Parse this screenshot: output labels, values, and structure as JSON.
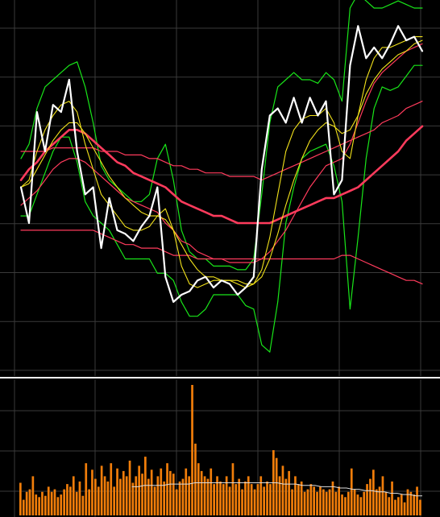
{
  "colors": {
    "background": "#000000",
    "grid": "#3a3a3a",
    "price": "#ffffff",
    "ma_short": "#f2e21b",
    "ma_long": "#ff3b5c",
    "bollinger": "#19e619",
    "volume": "#f07d0a",
    "volume_avg": "#dddddd",
    "separator": "#ffffff"
  },
  "chart_data": [
    {
      "type": "line",
      "panel": "price",
      "title": "",
      "xlabel": "",
      "ylabel": "",
      "grid": true,
      "x": [
        0,
        4,
        8,
        12,
        16,
        20,
        24,
        28,
        32,
        36,
        40,
        44,
        48,
        52,
        56,
        60,
        64,
        68,
        72,
        76,
        80,
        84,
        88,
        92,
        96,
        100,
        104,
        108,
        112,
        116,
        120,
        124,
        128,
        132,
        136,
        140,
        144,
        148,
        152,
        156,
        160,
        164,
        168,
        172,
        176,
        180,
        184,
        188,
        192,
        196,
        200
      ],
      "ylim": [
        0,
        100
      ],
      "series": [
        {
          "role": "price",
          "values": [
            50,
            40,
            71,
            60,
            73,
            71,
            80,
            60,
            48,
            50,
            33,
            47,
            38,
            37,
            35,
            39,
            42,
            50,
            25,
            18,
            20,
            21,
            24,
            25,
            22,
            24,
            23,
            20,
            22,
            25,
            55,
            70,
            72,
            68,
            75,
            68,
            75,
            70,
            74,
            48,
            52,
            84,
            95,
            86,
            89,
            86,
            90,
            95,
            91,
            92,
            88
          ]
        },
        {
          "role": "ma_short",
          "values": [
            50,
            52,
            60,
            66,
            70,
            73,
            74,
            71,
            62,
            55,
            48,
            45,
            42,
            39,
            38,
            38,
            39,
            42,
            44,
            38,
            28,
            23,
            22,
            23,
            24,
            24,
            24,
            23,
            22,
            23,
            27,
            36,
            48,
            60,
            66,
            69,
            70,
            70,
            72,
            68,
            60,
            58,
            70,
            80,
            86,
            89,
            89,
            90,
            91,
            92,
            92
          ]
        },
        {
          "role": "ma_short",
          "values": [
            50,
            51,
            55,
            59,
            63,
            66,
            68,
            68,
            65,
            61,
            57,
            53,
            50,
            47,
            45,
            43,
            42,
            42,
            41,
            38,
            34,
            30,
            27,
            25,
            25,
            24,
            24,
            24,
            23,
            23,
            25,
            30,
            37,
            45,
            52,
            58,
            63,
            66,
            68,
            67,
            65,
            66,
            70,
            76,
            80,
            83,
            85,
            87,
            88,
            90,
            91
          ]
        },
        {
          "role": "ma_long",
          "values": [
            60,
            60,
            60,
            60,
            61,
            61,
            61,
            61,
            61,
            61,
            60,
            60,
            60,
            59,
            59,
            59,
            58,
            58,
            57,
            56,
            56,
            55,
            55,
            54,
            54,
            54,
            53,
            53,
            53,
            53,
            52,
            53,
            54,
            55,
            56,
            57,
            58,
            59,
            60,
            61,
            62,
            63,
            64,
            65,
            66,
            68,
            69,
            70,
            72,
            73,
            74
          ]
        },
        {
          "role": "ma_long",
          "values": [
            52,
            55,
            57,
            60,
            62,
            64,
            66,
            66,
            65,
            63,
            61,
            59,
            57,
            56,
            54,
            53,
            52,
            51,
            50,
            48,
            46,
            45,
            44,
            43,
            42,
            42,
            41,
            40,
            40,
            40,
            40,
            40,
            41,
            42,
            43,
            44,
            45,
            46,
            47,
            47,
            48,
            49,
            50,
            52,
            54,
            56,
            58,
            60,
            63,
            65,
            67
          ]
        },
        {
          "role": "ma_long",
          "values": [
            45,
            47,
            49,
            52,
            55,
            57,
            58,
            58,
            57,
            55,
            53,
            51,
            49,
            47,
            46,
            45,
            44,
            43,
            40,
            38,
            35,
            34,
            32,
            31,
            30,
            30,
            29,
            29,
            29,
            29,
            30,
            32,
            35,
            38,
            42,
            46,
            50,
            53,
            56,
            57,
            58,
            62,
            68,
            74,
            79,
            82,
            84,
            86,
            88,
            89,
            90
          ]
        },
        {
          "role": "ma_long",
          "values": [
            38,
            38,
            38,
            38,
            38,
            38,
            38,
            38,
            38,
            38,
            37,
            36,
            35,
            34,
            34,
            33,
            33,
            33,
            32,
            31,
            31,
            31,
            30,
            30,
            30,
            30,
            30,
            30,
            30,
            30,
            30,
            30,
            30,
            30,
            30,
            30,
            30,
            30,
            30,
            30,
            31,
            31,
            30,
            29,
            28,
            27,
            26,
            25,
            24,
            24,
            23
          ]
        },
        {
          "role": "bollinger",
          "values": [
            58,
            62,
            72,
            78,
            80,
            82,
            84,
            85,
            78,
            68,
            56,
            52,
            50,
            48,
            46,
            46,
            48,
            58,
            62,
            52,
            38,
            32,
            30,
            30,
            28,
            28,
            28,
            27,
            27,
            30,
            48,
            68,
            78,
            80,
            82,
            80,
            80,
            79,
            82,
            80,
            74,
            100,
            104,
            102,
            100,
            100,
            101,
            102,
            101,
            100,
            100
          ]
        },
        {
          "role": "bollinger",
          "values": [
            42,
            42,
            48,
            54,
            60,
            64,
            64,
            57,
            46,
            42,
            40,
            38,
            34,
            30,
            30,
            30,
            30,
            26,
            26,
            24,
            18,
            14,
            14,
            16,
            20,
            20,
            20,
            20,
            17,
            16,
            6,
            4,
            18,
            40,
            50,
            58,
            60,
            61,
            62,
            56,
            46,
            16,
            36,
            58,
            72,
            78,
            77,
            78,
            81,
            84,
            84
          ]
        }
      ]
    },
    {
      "type": "bar",
      "panel": "volume",
      "title": "",
      "xlabel": "",
      "ylabel": "",
      "grid": true,
      "ylim": [
        0,
        100
      ],
      "values": [
        25,
        12,
        18,
        20,
        30,
        16,
        14,
        18,
        15,
        22,
        18,
        20,
        14,
        16,
        20,
        24,
        22,
        30,
        18,
        26,
        15,
        40,
        20,
        35,
        28,
        22,
        38,
        30,
        26,
        40,
        22,
        36,
        28,
        34,
        30,
        42,
        25,
        30,
        38,
        32,
        45,
        28,
        35,
        22,
        30,
        36,
        26,
        40,
        34,
        32,
        20,
        26,
        28,
        36,
        30,
        100,
        55,
        40,
        34,
        30,
        28,
        36,
        24,
        30,
        26,
        24,
        30,
        22,
        40,
        24,
        28,
        20,
        26,
        30,
        24,
        20,
        24,
        30,
        22,
        26,
        24,
        50,
        44,
        30,
        38,
        28,
        34,
        20,
        30,
        24,
        26,
        18,
        20,
        24,
        22,
        18,
        22,
        20,
        18,
        20,
        26,
        18,
        22,
        16,
        14,
        18,
        36,
        20,
        16,
        14,
        18,
        24,
        28,
        35,
        20,
        22,
        30,
        18,
        14,
        26,
        12,
        14,
        16,
        10,
        20,
        18,
        16,
        22,
        12
      ],
      "series": [
        {
          "role": "volume_avg",
          "start_index": 36,
          "values": [
            22,
            22,
            23,
            23,
            23,
            23,
            24,
            24,
            24,
            24,
            25,
            25,
            25,
            25,
            25,
            25,
            25,
            25,
            25,
            25,
            25,
            25,
            25,
            25,
            24,
            24,
            24,
            23,
            23,
            23,
            22,
            22,
            22,
            21,
            21,
            20,
            20,
            19,
            19,
            18,
            18,
            17,
            17,
            16,
            16,
            15,
            15
          ]
        }
      ]
    }
  ]
}
